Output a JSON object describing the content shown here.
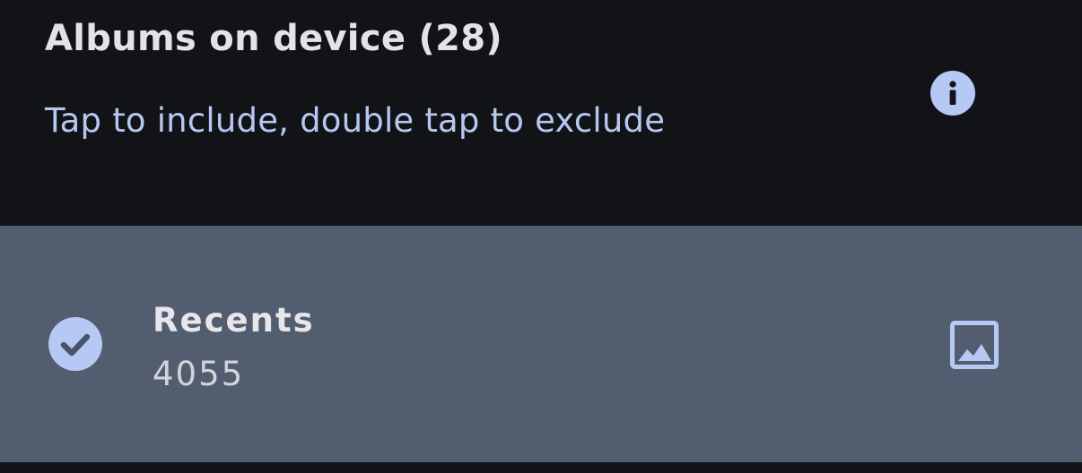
{
  "header": {
    "title": "Albums on device (28)",
    "subtitle": "Tap to include, double tap to exclude",
    "info_icon": "info-icon"
  },
  "albums": [
    {
      "name": "Recents",
      "count": "4055",
      "selected": true,
      "status_icon": "check-circle-icon",
      "thumbnail_icon": "image-icon"
    }
  ],
  "colors": {
    "background": "#121317",
    "accent": "#b6c9f5",
    "subtitle_text": "#b6c7f0",
    "row_selected": "#525d70",
    "title_text": "#e4e2e6"
  }
}
